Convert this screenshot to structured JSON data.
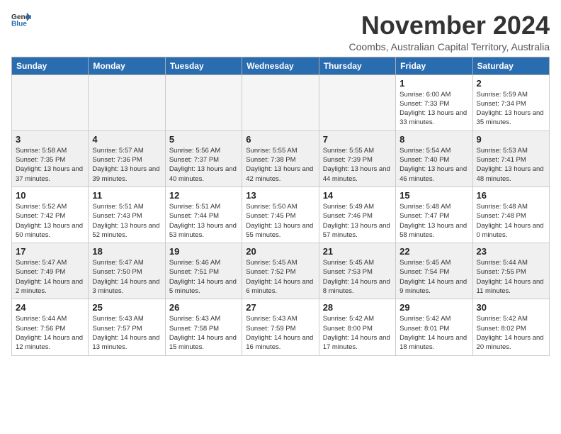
{
  "logo": {
    "text_general": "General",
    "text_blue": "Blue"
  },
  "title": "November 2024",
  "location": "Coombs, Australian Capital Territory, Australia",
  "days_of_week": [
    "Sunday",
    "Monday",
    "Tuesday",
    "Wednesday",
    "Thursday",
    "Friday",
    "Saturday"
  ],
  "weeks": [
    {
      "alt": false,
      "days": [
        {
          "num": "",
          "empty": true
        },
        {
          "num": "",
          "empty": true
        },
        {
          "num": "",
          "empty": true
        },
        {
          "num": "",
          "empty": true
        },
        {
          "num": "",
          "empty": true
        },
        {
          "num": "1",
          "sunrise": "Sunrise: 6:00 AM",
          "sunset": "Sunset: 7:33 PM",
          "daylight": "Daylight: 13 hours and 33 minutes."
        },
        {
          "num": "2",
          "sunrise": "Sunrise: 5:59 AM",
          "sunset": "Sunset: 7:34 PM",
          "daylight": "Daylight: 13 hours and 35 minutes."
        }
      ]
    },
    {
      "alt": true,
      "days": [
        {
          "num": "3",
          "sunrise": "Sunrise: 5:58 AM",
          "sunset": "Sunset: 7:35 PM",
          "daylight": "Daylight: 13 hours and 37 minutes."
        },
        {
          "num": "4",
          "sunrise": "Sunrise: 5:57 AM",
          "sunset": "Sunset: 7:36 PM",
          "daylight": "Daylight: 13 hours and 39 minutes."
        },
        {
          "num": "5",
          "sunrise": "Sunrise: 5:56 AM",
          "sunset": "Sunset: 7:37 PM",
          "daylight": "Daylight: 13 hours and 40 minutes."
        },
        {
          "num": "6",
          "sunrise": "Sunrise: 5:55 AM",
          "sunset": "Sunset: 7:38 PM",
          "daylight": "Daylight: 13 hours and 42 minutes."
        },
        {
          "num": "7",
          "sunrise": "Sunrise: 5:55 AM",
          "sunset": "Sunset: 7:39 PM",
          "daylight": "Daylight: 13 hours and 44 minutes."
        },
        {
          "num": "8",
          "sunrise": "Sunrise: 5:54 AM",
          "sunset": "Sunset: 7:40 PM",
          "daylight": "Daylight: 13 hours and 46 minutes."
        },
        {
          "num": "9",
          "sunrise": "Sunrise: 5:53 AM",
          "sunset": "Sunset: 7:41 PM",
          "daylight": "Daylight: 13 hours and 48 minutes."
        }
      ]
    },
    {
      "alt": false,
      "days": [
        {
          "num": "10",
          "sunrise": "Sunrise: 5:52 AM",
          "sunset": "Sunset: 7:42 PM",
          "daylight": "Daylight: 13 hours and 50 minutes."
        },
        {
          "num": "11",
          "sunrise": "Sunrise: 5:51 AM",
          "sunset": "Sunset: 7:43 PM",
          "daylight": "Daylight: 13 hours and 52 minutes."
        },
        {
          "num": "12",
          "sunrise": "Sunrise: 5:51 AM",
          "sunset": "Sunset: 7:44 PM",
          "daylight": "Daylight: 13 hours and 53 minutes."
        },
        {
          "num": "13",
          "sunrise": "Sunrise: 5:50 AM",
          "sunset": "Sunset: 7:45 PM",
          "daylight": "Daylight: 13 hours and 55 minutes."
        },
        {
          "num": "14",
          "sunrise": "Sunrise: 5:49 AM",
          "sunset": "Sunset: 7:46 PM",
          "daylight": "Daylight: 13 hours and 57 minutes."
        },
        {
          "num": "15",
          "sunrise": "Sunrise: 5:48 AM",
          "sunset": "Sunset: 7:47 PM",
          "daylight": "Daylight: 13 hours and 58 minutes."
        },
        {
          "num": "16",
          "sunrise": "Sunrise: 5:48 AM",
          "sunset": "Sunset: 7:48 PM",
          "daylight": "Daylight: 14 hours and 0 minutes."
        }
      ]
    },
    {
      "alt": true,
      "days": [
        {
          "num": "17",
          "sunrise": "Sunrise: 5:47 AM",
          "sunset": "Sunset: 7:49 PM",
          "daylight": "Daylight: 14 hours and 2 minutes."
        },
        {
          "num": "18",
          "sunrise": "Sunrise: 5:47 AM",
          "sunset": "Sunset: 7:50 PM",
          "daylight": "Daylight: 14 hours and 3 minutes."
        },
        {
          "num": "19",
          "sunrise": "Sunrise: 5:46 AM",
          "sunset": "Sunset: 7:51 PM",
          "daylight": "Daylight: 14 hours and 5 minutes."
        },
        {
          "num": "20",
          "sunrise": "Sunrise: 5:45 AM",
          "sunset": "Sunset: 7:52 PM",
          "daylight": "Daylight: 14 hours and 6 minutes."
        },
        {
          "num": "21",
          "sunrise": "Sunrise: 5:45 AM",
          "sunset": "Sunset: 7:53 PM",
          "daylight": "Daylight: 14 hours and 8 minutes."
        },
        {
          "num": "22",
          "sunrise": "Sunrise: 5:45 AM",
          "sunset": "Sunset: 7:54 PM",
          "daylight": "Daylight: 14 hours and 9 minutes."
        },
        {
          "num": "23",
          "sunrise": "Sunrise: 5:44 AM",
          "sunset": "Sunset: 7:55 PM",
          "daylight": "Daylight: 14 hours and 11 minutes."
        }
      ]
    },
    {
      "alt": false,
      "days": [
        {
          "num": "24",
          "sunrise": "Sunrise: 5:44 AM",
          "sunset": "Sunset: 7:56 PM",
          "daylight": "Daylight: 14 hours and 12 minutes."
        },
        {
          "num": "25",
          "sunrise": "Sunrise: 5:43 AM",
          "sunset": "Sunset: 7:57 PM",
          "daylight": "Daylight: 14 hours and 13 minutes."
        },
        {
          "num": "26",
          "sunrise": "Sunrise: 5:43 AM",
          "sunset": "Sunset: 7:58 PM",
          "daylight": "Daylight: 14 hours and 15 minutes."
        },
        {
          "num": "27",
          "sunrise": "Sunrise: 5:43 AM",
          "sunset": "Sunset: 7:59 PM",
          "daylight": "Daylight: 14 hours and 16 minutes."
        },
        {
          "num": "28",
          "sunrise": "Sunrise: 5:42 AM",
          "sunset": "Sunset: 8:00 PM",
          "daylight": "Daylight: 14 hours and 17 minutes."
        },
        {
          "num": "29",
          "sunrise": "Sunrise: 5:42 AM",
          "sunset": "Sunset: 8:01 PM",
          "daylight": "Daylight: 14 hours and 18 minutes."
        },
        {
          "num": "30",
          "sunrise": "Sunrise: 5:42 AM",
          "sunset": "Sunset: 8:02 PM",
          "daylight": "Daylight: 14 hours and 20 minutes."
        }
      ]
    }
  ]
}
